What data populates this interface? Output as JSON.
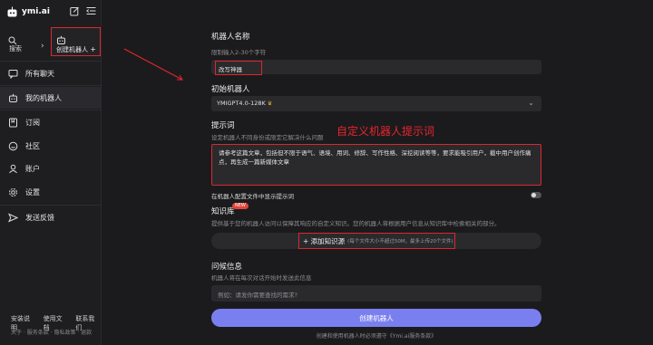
{
  "app": {
    "name": "ymi.ai"
  },
  "sidebar": {
    "search_label": "搜索",
    "create_bot_label": "创建机器人",
    "create_bot_plus": "+",
    "items": [
      {
        "label": "所有聊天",
        "icon": "chat-icon"
      },
      {
        "label": "我的机器人",
        "icon": "robot-icon"
      },
      {
        "label": "订阅",
        "icon": "bookmark-icon"
      },
      {
        "label": "社区",
        "icon": "community-icon"
      },
      {
        "label": "账户",
        "icon": "user-icon"
      },
      {
        "label": "设置",
        "icon": "gear-icon"
      },
      {
        "label": "发送反馈",
        "icon": "send-icon"
      }
    ],
    "footer_links": [
      "安装说明",
      "使用文档",
      "联系我们"
    ],
    "footer_sub": "关于 · 服务条款 · 隐私政策 · 退款"
  },
  "form": {
    "name_title": "机器人名称",
    "name_hint": "限制输入2-30个字符",
    "name_value": "改写神器",
    "init_title": "初始机器人",
    "init_value": "YMIGPT4.0-128K",
    "prompt_title": "提示词",
    "prompt_hint": "设定机器人不同身份或限定它解决什么问题",
    "annotation": "自定义机器人提示词",
    "prompt_value": "请参考这篇文章，包括但不限于语气、语境、用词、修辞、写作性格、深挖阅读等等，要求能吸引用户，截中用户创作痛点，再生成一篇新媒体文章",
    "toggle_label": "在机器人配置文件中显示提示词",
    "toggle_on": false,
    "knowledge_title": "知识库",
    "knowledge_badge": "NEW",
    "knowledge_hint": "提供基于您的机器人访问以保障其响应的自定义知识。您的机器人将根据用户信息从知识库中检索相关的部分。",
    "add_knowledge_label": "+ 添加知识源",
    "add_knowledge_sub": "(每个文件大小不超过50M，最多上传20个文件)",
    "question_title": "问候信息",
    "question_hint": "机器人将在每次对话开始时发送此信息",
    "question_placeholder": "例如：请发你需要查找的需求?",
    "create_button": "创建机器人",
    "agreement": "创建和使用机器人时必须遵守《Ymi.ai服务条款》"
  },
  "colors": {
    "accent": "#7a7ff0",
    "highlight": "#d9282f",
    "background": "#1b1b1d"
  }
}
